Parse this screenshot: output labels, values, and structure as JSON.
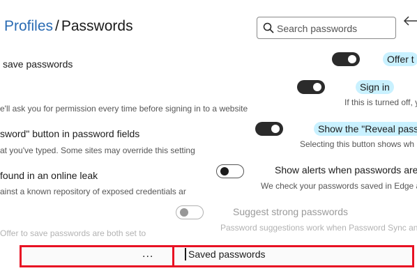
{
  "header": {
    "breadcrumb": "Profiles",
    "separator": "/",
    "title": "Passwords",
    "search_placeholder": "Search passwords"
  },
  "right_column": {
    "offer_label": "Offer t",
    "signin_label": "Sign in",
    "signin_desc": "If this is turned off, y",
    "reveal_label": "Show the \"Reveal pass",
    "reveal_desc": "Selecting this button shows wh",
    "alerts_label": "Show alerts when passwords are",
    "alerts_desc": "We check your passwords saved in Edge ag",
    "suggest_label": "Suggest strong passwords",
    "suggest_desc": "Password suggestions work when Password Sync and"
  },
  "left_column": {
    "offer_label": "save passwords",
    "signin_desc": "e'll ask you for permission every time before signing in to a website",
    "reveal_label": "sword\" button in password fields",
    "reveal_desc": "at you've typed. Some sites may override this setting",
    "alerts_label": "found in an online leak",
    "alerts_desc": "ainst a known repository of exposed credentials ar",
    "suggest_desc": "Offer to save passwords are both set to"
  },
  "footer": {
    "more_label": "...",
    "saved_label": "Saved passwords"
  },
  "toggles": {
    "offer": "on",
    "signin": "on",
    "reveal": "on",
    "alerts": "off",
    "suggest": "off"
  },
  "colors": {
    "accent": "#2a6bb3",
    "toggle_on": "#2b2b2b",
    "highlight_pill": "#c9f1ff",
    "annotation_red": "#e81123"
  }
}
